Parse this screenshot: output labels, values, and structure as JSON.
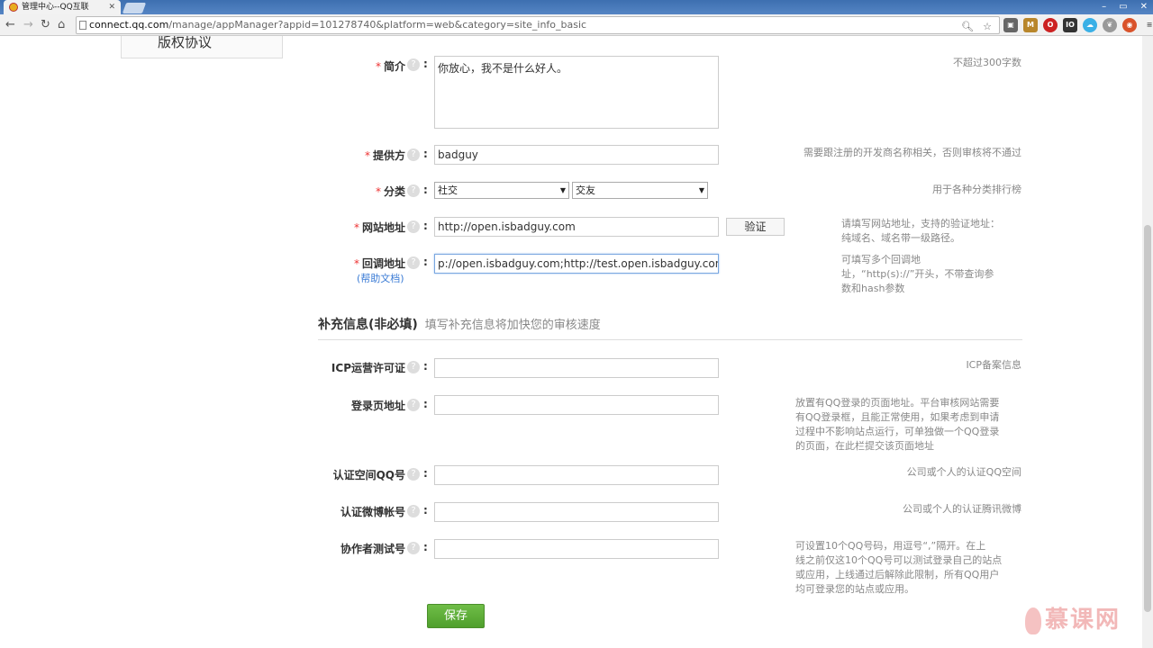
{
  "browser": {
    "tab_title": "管理中心--QQ互联",
    "url_host": "connect.qq.com",
    "url_rest": "/manage/appManager?appid=101278740&platform=web&category=site_info_basic"
  },
  "sidebar": {
    "item": "版权协议"
  },
  "form": {
    "intro": {
      "label": "简介",
      "value": "你放心，我不是什么好人。",
      "hint": "不超过300字数"
    },
    "provider": {
      "label": "提供方",
      "value": "badguy",
      "hint": "需要跟注册的开发商名称相关，否则审核将不通过"
    },
    "category": {
      "label": "分类",
      "value1": "社交",
      "value2": "交友",
      "hint": "用于各种分类排行榜"
    },
    "website": {
      "label": "网站地址",
      "value": "http://open.isbadguy.com",
      "verify": "验证",
      "hint1": "请填写网站地址，支持的验证地址：",
      "hint2": "纯域名、域名带一级路径。"
    },
    "callback": {
      "label": "回调地址",
      "help_link": "(帮助文档)",
      "value": "p://open.isbadguy.com;http://test.open.isbadguy.com",
      "hint1": "可填写多个回调地",
      "hint2": "址，“http(s)://”开头，不带查询参",
      "hint3": "数和hash参数"
    }
  },
  "supplement": {
    "title": "补充信息(非必填)",
    "subtitle": "填写补充信息将加快您的审核速度",
    "icp": {
      "label": "ICP运营许可证",
      "hint": "ICP备案信息"
    },
    "login_page": {
      "label": "登录页地址",
      "hint1": "放置有QQ登录的页面地址。平台审核网站需要",
      "hint2": "有QQ登录框，且能正常使用，如果考虑到申请",
      "hint3": "过程中不影响站点运行，可单独做一个QQ登录",
      "hint4": "的页面，在此栏提交该页面地址"
    },
    "qzone": {
      "label": "认证空间QQ号",
      "hint": "公司或个人的认证QQ空间"
    },
    "weibo": {
      "label": "认证微博帐号",
      "hint": "公司或个人的认证腾讯微博"
    },
    "testers": {
      "label": "协作者测试号",
      "hint1": "可设置10个QQ号码，用逗号“,”隔开。在上",
      "hint2": "线之前仅这10个QQ号可以测试登录自己的站点",
      "hint3": "或应用，上线通过后解除此限制，所有QQ用户",
      "hint4": "均可登录您的站点或应用。"
    }
  },
  "save_label": "保存",
  "required_mark": "*",
  "help_mark": "?",
  "colon": ":",
  "watermark": "慕课网"
}
